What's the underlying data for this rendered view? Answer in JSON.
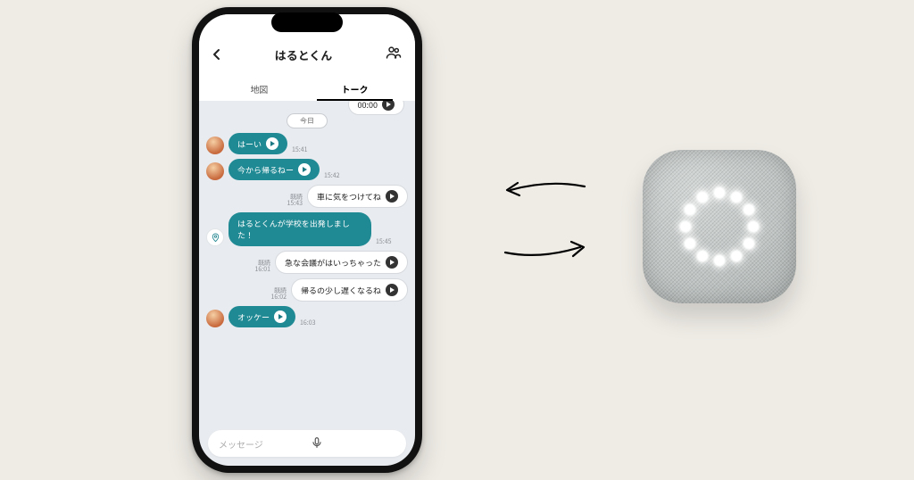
{
  "header": {
    "title": "はるとくん",
    "back_icon": "chevron-left",
    "group_icon": "group"
  },
  "tabs": {
    "map": "地図",
    "talk": "トーク",
    "active": "talk"
  },
  "day_separator": "今日",
  "read_label": "既読",
  "messages": [
    {
      "type": "partial_out",
      "time": "00:00"
    },
    {
      "type": "in_voice",
      "text": "はーい",
      "time": "15:41",
      "avatar": true
    },
    {
      "type": "in_voice",
      "text": "今から帰るねー",
      "time": "15:42",
      "avatar": true
    },
    {
      "type": "out_voice",
      "text": "車に気をつけてね",
      "time": "15:43",
      "read": true
    },
    {
      "type": "in_location",
      "text": "はるとくんが学校を出発しました！",
      "time": "15:45"
    },
    {
      "type": "out_voice",
      "text": "急な会議がはいっちゃった",
      "time": "16:01",
      "read": true
    },
    {
      "type": "out_voice",
      "text": "帰るの少し遅くなるね",
      "time": "16:02",
      "read": true
    },
    {
      "type": "in_voice",
      "text": "オッケー",
      "time": "16:03",
      "avatar": true
    }
  ],
  "input": {
    "placeholder": "メッセージ",
    "mic_icon": "mic"
  },
  "device": {
    "led_count": 12
  }
}
